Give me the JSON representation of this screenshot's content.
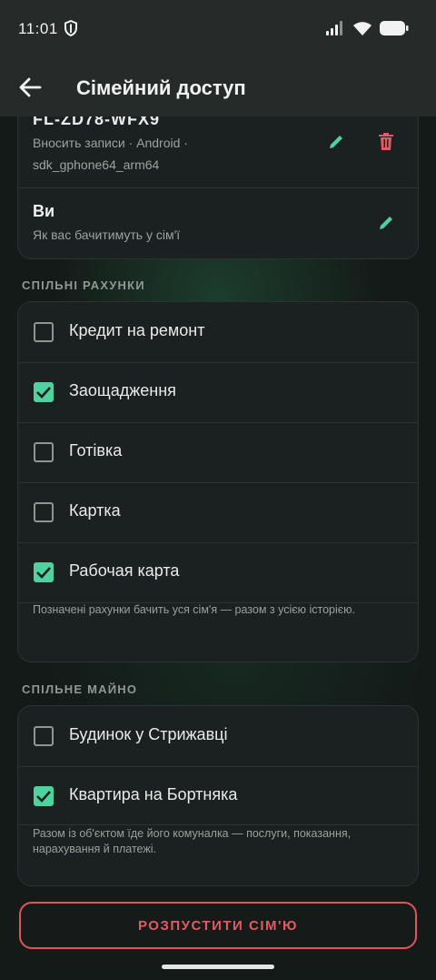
{
  "status_bar": {
    "time": "11:01"
  },
  "app_bar": {
    "title": "Сімейний доступ"
  },
  "device_card": {
    "device_name": "FL-ZD78-WFX9",
    "device_sub1": "Вносить записи · Android ·",
    "device_sub2": "sdk_gphone64_arm64",
    "you_name": "Ви",
    "you_sub": "Як вас бачитимуть у сім'ї"
  },
  "shared_accounts": {
    "label": "СПІЛЬНІ РАХУНКИ",
    "items": [
      {
        "label": "Кредит на ремонт",
        "checked": false
      },
      {
        "label": "Заощадження",
        "checked": true
      },
      {
        "label": "Готівка",
        "checked": false
      },
      {
        "label": "Картка",
        "checked": false
      },
      {
        "label": "Рабочая карта",
        "checked": true
      }
    ],
    "note": "Позначені рахунки бачить уся сім'я — разом з усією історією."
  },
  "shared_property": {
    "label": "СПІЛЬНЕ МАЙНО",
    "items": [
      {
        "label": "Будинок у Стрижавці",
        "checked": false
      },
      {
        "label": "Квартира на Бортняка",
        "checked": true
      }
    ],
    "note": "Разом із об'єктом їде його комуналка — послуги, показання, нарахування й платежі."
  },
  "dissolve_button": "РОЗПУСТИТИ СІМ'Ю",
  "colors": {
    "accent": "#4fd1a0",
    "danger": "#e35a62",
    "background": "#141a18",
    "card": "#1b2120"
  }
}
